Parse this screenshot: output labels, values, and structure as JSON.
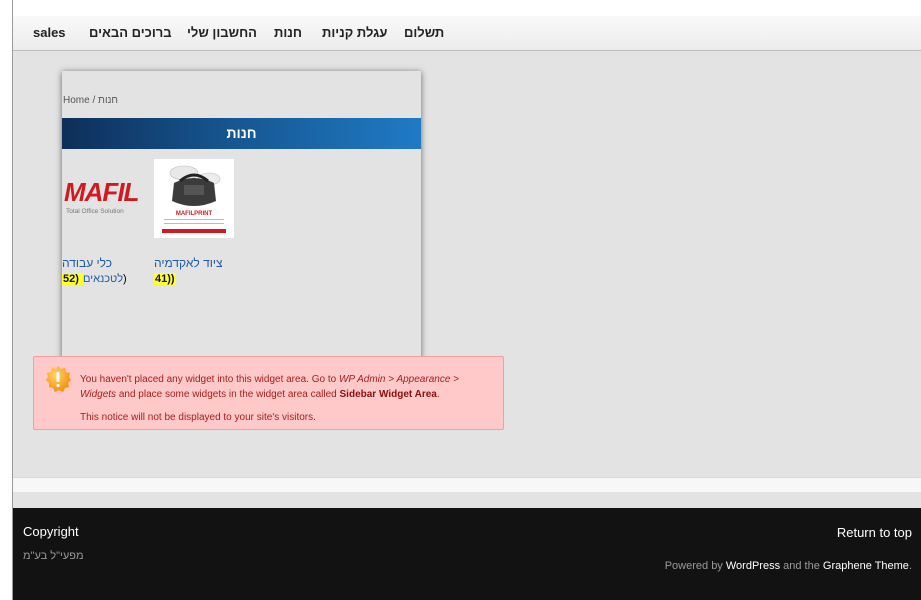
{
  "nav": {
    "items": [
      {
        "label": "sales"
      },
      {
        "label": "ברוכים הבאים"
      },
      {
        "label": "החשבון שלי"
      },
      {
        "label": "חנות"
      },
      {
        "label": "עגלת קניות"
      },
      {
        "label": "תשלום"
      }
    ]
  },
  "breadcrumb": {
    "home": "Home",
    "separator": " / ",
    "current": "חנות"
  },
  "category": {
    "title": "חנות"
  },
  "products": [
    {
      "title": "כלי עבודה",
      "count_open": "52) ",
      "count_text": "לטכנאים",
      "count_close": ")",
      "logo_text": "MAFIL",
      "logo_sub": "Total Office Solution"
    },
    {
      "title": "ציוד לאקדמיה",
      "count_open": "",
      "count_text": "",
      "count_close": "41))",
      "logo_text": "MAFILPRINT"
    }
  ],
  "notice": {
    "line1_pre": "You haven't placed any widget into this widget area. Go to ",
    "line1_link": "WP Admin > Appearance > Widgets",
    "line1_mid": " and place some widgets in the widget area called ",
    "line1_strong": "Sidebar Widget Area",
    "line1_end": ".",
    "line2": "This notice will not be displayed to your site's visitors."
  },
  "footer": {
    "copyright": "Copyright",
    "company": "מפעי\"ל בע\"מ",
    "return_to_top": "Return to top",
    "powered_pre": "Powered by ",
    "wordpress": "WordPress",
    "powered_mid": " and the ",
    "theme": "Graphene Theme",
    "powered_end": "."
  },
  "colors": {
    "category_bar_start": "#0d2f59",
    "category_bar_end": "#1f7bc5",
    "notice_bg": "#ffc9c9",
    "footer_bg": "#121212",
    "link_blue": "#1f5aa8",
    "highlight": "#ffff33"
  },
  "icons": {
    "notice": "warning-icon"
  }
}
